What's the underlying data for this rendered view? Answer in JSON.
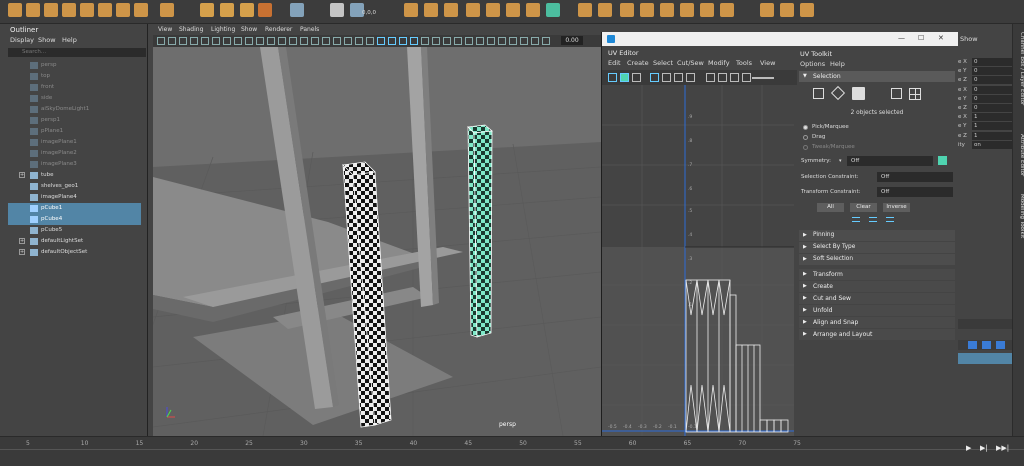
{
  "outliner": {
    "title": "Outliner",
    "menu": [
      "Display",
      "Show",
      "Help"
    ],
    "search_placeholder": "Search...",
    "items": [
      {
        "label": "persp",
        "state": "dim"
      },
      {
        "label": "top",
        "state": "dim"
      },
      {
        "label": "front",
        "state": "dim"
      },
      {
        "label": "side",
        "state": "dim"
      },
      {
        "label": "aiSkyDomeLight1",
        "state": "dim"
      },
      {
        "label": "persp1",
        "state": "dim"
      },
      {
        "label": "pPlane1",
        "state": "dim"
      },
      {
        "label": "imagePlane1",
        "state": "dim"
      },
      {
        "label": "imagePlane2",
        "state": "dim"
      },
      {
        "label": "imagePlane3",
        "state": "dim"
      },
      {
        "label": "tube",
        "state": "normal"
      },
      {
        "label": "shelves_geo1",
        "state": "normal"
      },
      {
        "label": "imagePlane4",
        "state": "normal"
      },
      {
        "label": "pCube1",
        "state": "selected"
      },
      {
        "label": "pCube4",
        "state": "selected"
      },
      {
        "label": "pCube5",
        "state": "normal"
      },
      {
        "label": "defaultLightSet",
        "state": "normal"
      },
      {
        "label": "defaultObjectSet",
        "state": "normal"
      }
    ]
  },
  "shelf": {
    "coord_label": "0,0,0"
  },
  "viewport": {
    "menu": [
      "View",
      "Shading",
      "Lighting",
      "Show",
      "Renderer",
      "Panels"
    ],
    "camera_label": "persp",
    "field_value": "0.00"
  },
  "uv_editor": {
    "title": "UV Editor",
    "menu": [
      "Edit",
      "Create",
      "Select",
      "Cut/Sew",
      "Modify",
      "Tools",
      "View"
    ],
    "v_ticks": [
      ".9",
      ".8",
      ".7",
      ".6",
      ".5",
      ".4",
      ".3",
      ".2",
      ".1",
      "-0.1",
      "-0.2",
      "-0.3",
      "-0.4"
    ],
    "u_ticks": [
      "-0.5",
      "-0.4",
      "-0.3",
      "-0.2",
      "-0.1"
    ]
  },
  "uv_toolkit": {
    "title": "UV Toolkit",
    "menu": [
      "Options",
      "Help"
    ],
    "selection_header": "Selection",
    "objects_selected": "2 objects selected",
    "modes": [
      {
        "label": "Pick/Marquee",
        "active": true
      },
      {
        "label": "Drag",
        "active": false
      },
      {
        "label": "Tweak/Marquee",
        "active": false
      }
    ],
    "symmetry_label": "Symmetry:",
    "symmetry_value": "Off",
    "selection_constraint_label": "Selection Constraint:",
    "selection_constraint_value": "Off",
    "transform_constraint_label": "Transform Constraint:",
    "transform_constraint_value": "Off",
    "buttons": [
      "All",
      "Clear",
      "Inverse"
    ],
    "subsections": [
      "Pinning",
      "Select By Type",
      "Soft Selection"
    ],
    "sections": [
      "Transform",
      "Create",
      "Cut and Sew",
      "Unfold",
      "Align and Snap",
      "Arrange and Layout"
    ]
  },
  "window_controls": {
    "minimize": "—",
    "maximize": "☐",
    "close": "✕",
    "show": "Show"
  },
  "channel_box": {
    "rows": [
      {
        "label": "e X",
        "value": "0"
      },
      {
        "label": "e Y",
        "value": "0"
      },
      {
        "label": "e Z",
        "value": "0"
      },
      {
        "label": "e X",
        "value": "0"
      },
      {
        "label": "e Y",
        "value": "0"
      },
      {
        "label": "e Z",
        "value": "0"
      },
      {
        "label": "e X",
        "value": "1"
      },
      {
        "label": "e Y",
        "value": "1"
      },
      {
        "label": "e Z",
        "value": "1"
      },
      {
        "label": "ity",
        "value": "on"
      }
    ]
  },
  "side_tabs": [
    "Channel Box / Layer Editor",
    "Attribute Editor",
    "Modeling Toolkit"
  ],
  "timeline": {
    "ticks": [
      "5",
      "10",
      "15",
      "20",
      "25",
      "30",
      "35",
      "40",
      "45",
      "50",
      "55",
      "60",
      "65",
      "70",
      "75"
    ]
  },
  "colors": {
    "selection": "#5285a6",
    "accent_teal": "#4fd4b0",
    "uv_blue": "#2d6cd6"
  }
}
